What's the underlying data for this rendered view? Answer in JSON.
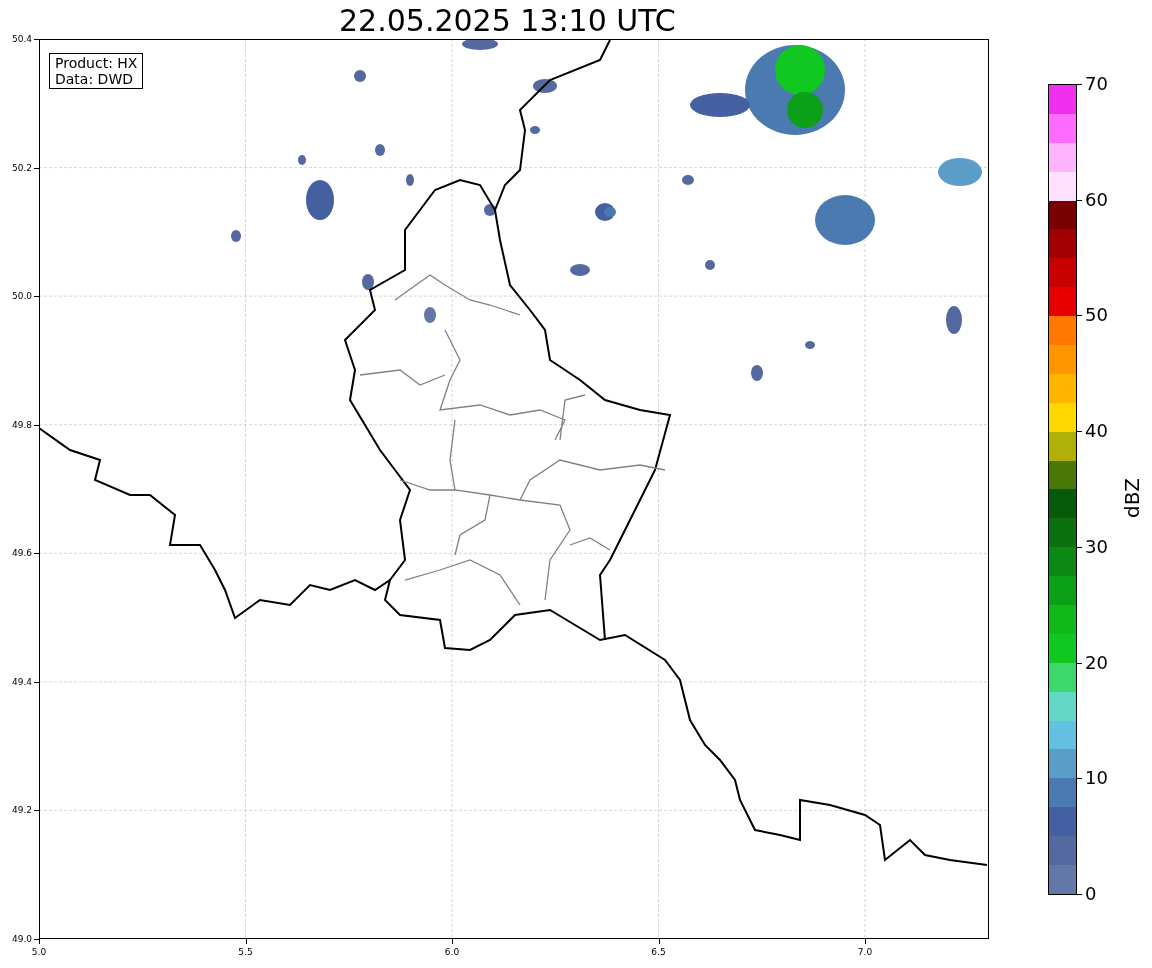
{
  "title": "22.05.2025 13:10 UTC",
  "info_box": {
    "lines": [
      "Product: HX",
      "Data: DWD"
    ]
  },
  "y_axis": {
    "ticks": [
      "50.4",
      "50.2",
      "50.0",
      "49.8",
      "49.6",
      "49.4",
      "49.2",
      "49.0"
    ]
  },
  "x_axis": {
    "ticks": [
      "5.0",
      "5.5",
      "6.0",
      "6.5",
      "7.0"
    ]
  },
  "colorbar": {
    "label": "dBZ",
    "ticks": [
      "70",
      "60",
      "50",
      "40",
      "30",
      "20",
      "10",
      "0"
    ],
    "bands": [
      {
        "color": "#f030f0"
      },
      {
        "color": "#ff6cff"
      },
      {
        "color": "#ffb4ff"
      },
      {
        "color": "#ffe0ff"
      },
      {
        "color": "#780000"
      },
      {
        "color": "#a00000"
      },
      {
        "color": "#c80000"
      },
      {
        "color": "#e80000"
      },
      {
        "color": "#ff7800"
      },
      {
        "color": "#ff9600"
      },
      {
        "color": "#ffb400"
      },
      {
        "color": "#ffd800"
      },
      {
        "color": "#b0b008"
      },
      {
        "color": "#4a7808"
      },
      {
        "color": "#065a0a"
      },
      {
        "color": "#0a7010"
      },
      {
        "color": "#0c8814"
      },
      {
        "color": "#0ca018"
      },
      {
        "color": "#10b818"
      },
      {
        "color": "#10c820"
      },
      {
        "color": "#3cd86c"
      },
      {
        "color": "#64d8c8"
      },
      {
        "color": "#64c0e0"
      },
      {
        "color": "#5a9ec8"
      },
      {
        "color": "#4a7ab0"
      },
      {
        "color": "#4460a0"
      },
      {
        "color": "#5469a0"
      },
      {
        "color": "#6478a8"
      }
    ]
  }
}
